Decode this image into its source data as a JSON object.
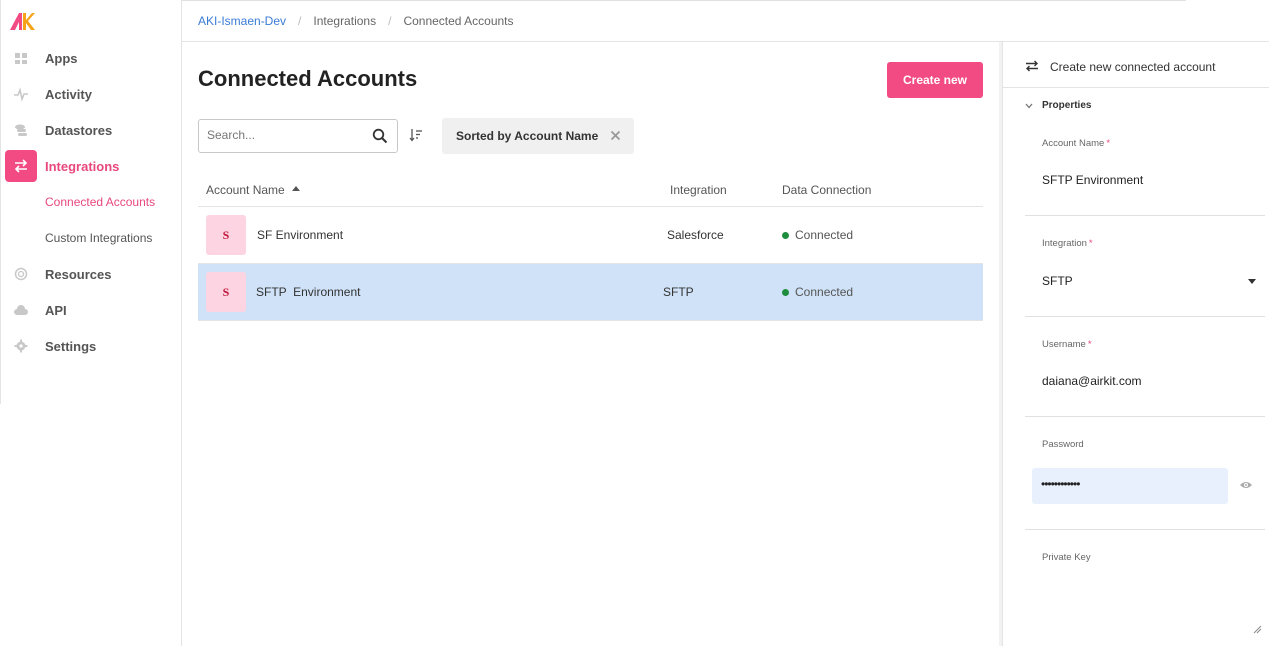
{
  "brand": {
    "logo_text": "AK",
    "accent": "#f24b84"
  },
  "sidebar": {
    "items": [
      {
        "label": "Apps",
        "icon": "grid-icon"
      },
      {
        "label": "Activity",
        "icon": "pulse-icon"
      },
      {
        "label": "Datastores",
        "icon": "database-icon"
      },
      {
        "label": "Integrations",
        "icon": "swap-icon",
        "active": true
      },
      {
        "label": "Resources",
        "icon": "globe-icon"
      },
      {
        "label": "API",
        "icon": "cloud-icon"
      },
      {
        "label": "Settings",
        "icon": "gear-icon"
      }
    ],
    "sub_items": [
      {
        "label": "Connected Accounts",
        "active": true
      },
      {
        "label": "Custom Integrations"
      }
    ]
  },
  "breadcrumb": [
    "AKI-Ismaen-Dev",
    "Integrations",
    "Connected Accounts"
  ],
  "main": {
    "title": "Connected Accounts",
    "create_button": "Create new",
    "search_placeholder": "Search...",
    "sort_chip": "Sorted by Account Name",
    "columns": [
      "Account Name",
      "Integration",
      "Data Connection"
    ],
    "rows": [
      {
        "avatar": "S",
        "name": "SF Environment",
        "integration": "Salesforce",
        "status": "Connected"
      },
      {
        "avatar": "S",
        "name": "SFTP  Environment",
        "integration": "SFTP",
        "status": "Connected",
        "selected": true
      }
    ]
  },
  "panel": {
    "title": "Create new connected account",
    "section": "Properties",
    "fields": {
      "account_name": {
        "label": "Account Name",
        "required": "*",
        "value": "SFTP Environment"
      },
      "integration": {
        "label": "Integration",
        "required": "*",
        "value": "SFTP"
      },
      "username": {
        "label": "Username",
        "required": "*",
        "value": "daiana@airkit.com"
      },
      "password": {
        "label": "Password",
        "value": "••••••••••••"
      },
      "private_key": {
        "label": "Private Key",
        "value": ""
      }
    }
  }
}
